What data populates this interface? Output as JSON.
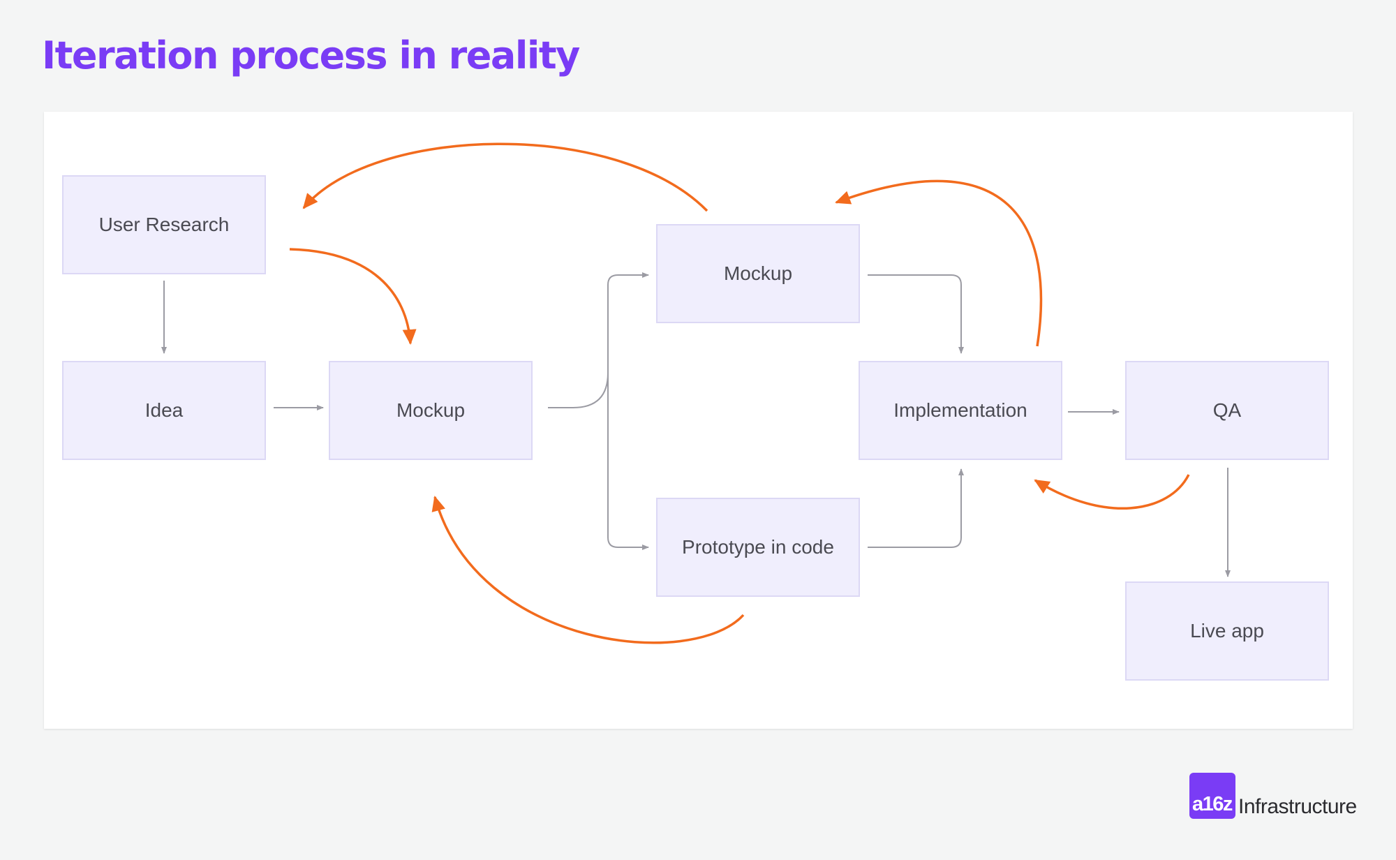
{
  "title": "Iteration process in reality",
  "nodes": {
    "user_research": "User Research",
    "idea": "Idea",
    "mockup_main": "Mockup",
    "mockup_top": "Mockup",
    "prototype": "Prototype in code",
    "implementation": "Implementation",
    "qa": "QA",
    "live_app": "Live app"
  },
  "edges": [
    {
      "from": "User Research",
      "to": "Idea",
      "kind": "flow"
    },
    {
      "from": "Idea",
      "to": "Mockup",
      "kind": "flow"
    },
    {
      "from": "Mockup",
      "to": "Mockup",
      "kind": "flow"
    },
    {
      "from": "Mockup",
      "to": "Prototype in code",
      "kind": "flow"
    },
    {
      "from": "Mockup",
      "to": "Implementation",
      "kind": "flow"
    },
    {
      "from": "Prototype in code",
      "to": "Implementation",
      "kind": "flow"
    },
    {
      "from": "Implementation",
      "to": "QA",
      "kind": "flow"
    },
    {
      "from": "QA",
      "to": "Live app",
      "kind": "flow"
    },
    {
      "from": "User Research",
      "to": "Mockup",
      "kind": "iteration"
    },
    {
      "from": "Mockup",
      "to": "User Research",
      "kind": "iteration"
    },
    {
      "from": "Implementation",
      "to": "Mockup",
      "kind": "iteration"
    },
    {
      "from": "QA",
      "to": "Implementation",
      "kind": "iteration"
    },
    {
      "from": "Prototype in code",
      "to": "Mockup",
      "kind": "iteration"
    }
  ],
  "colors": {
    "title": "#7a3cf5",
    "node_fill": "#f0eefd",
    "node_border": "#dcd8f5",
    "flow_arrow": "#9b9ba3",
    "iteration_arrow": "#f26b1d",
    "brand": "#7a3cf5"
  },
  "logo": {
    "mark": "a16z",
    "word": "Infrastructure"
  }
}
